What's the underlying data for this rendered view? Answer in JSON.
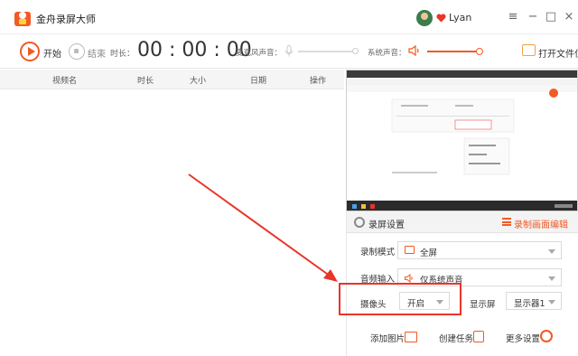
{
  "app": {
    "title": "金舟录屏大师",
    "username": "Lyan"
  },
  "window_controls": {
    "menu": "≡",
    "minimize": "−",
    "maximize": "□",
    "close": "×"
  },
  "toolbar": {
    "start_label": "开始",
    "pause_label": "结束",
    "duration_label": "时长：",
    "timer": "00 : 00 : 00",
    "mic_label": "麦克风声音：",
    "sys_label": "系统声音：",
    "open_folder_label": "打开文件位置",
    "mic_volume": 0,
    "system_volume": 1.0
  },
  "table": {
    "columns": [
      "视频名",
      "时长",
      "大小",
      "日期",
      "操作"
    ]
  },
  "settings": {
    "title": "录屏设置",
    "edit_area_label": "录制画面编辑",
    "record_mode_label": "录制模式",
    "record_mode_value": "全屏",
    "audio_input_label": "音频输入",
    "audio_input_value": "仅系统声音",
    "camera_label": "摄像头",
    "camera_value": "开启",
    "display_label": "显示屏",
    "display_value": "显示器1",
    "add_image_label": "添加图片",
    "create_task_label": "创建任务",
    "more_settings_label": "更多设置"
  },
  "colors": {
    "accent": "#f15a24",
    "annotation_red": "#e8352a"
  },
  "icons": [
    "app-logo-icon",
    "vip-heart-icon",
    "start-record-icon",
    "stop-record-icon",
    "microphone-icon",
    "speaker-icon",
    "folder-icon",
    "gear-icon",
    "edit-area-icon",
    "monitor-icon",
    "volume-icon",
    "image-icon",
    "task-icon",
    "more-settings-icon"
  ]
}
